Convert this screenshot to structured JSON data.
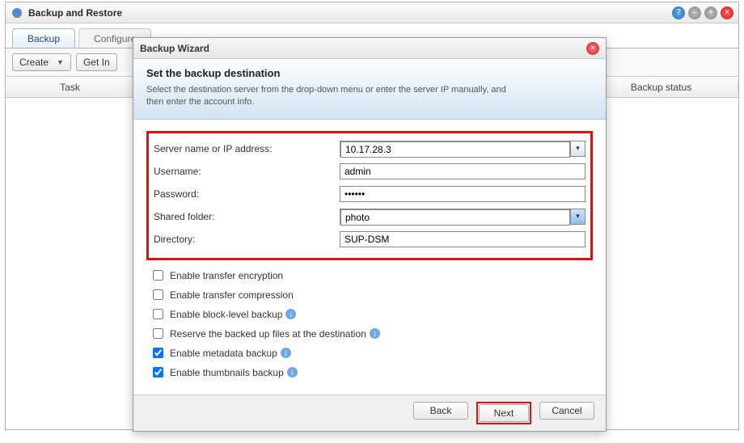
{
  "window": {
    "title": "Backup and Restore"
  },
  "tabs": {
    "backup": "Backup",
    "configure": "Configure"
  },
  "toolbar": {
    "create": "Create",
    "get_info": "Get Info"
  },
  "columns": {
    "task": "Task",
    "status": "Backup status"
  },
  "wizard": {
    "title": "Backup Wizard",
    "heading": "Set the backup destination",
    "desc": "Select the destination server from the drop-down menu or enter the server IP manually, and then enter the account info.",
    "labels": {
      "server": "Server name or IP address:",
      "username": "Username:",
      "password": "Password:",
      "folder": "Shared folder:",
      "directory": "Directory:"
    },
    "values": {
      "server": "10.17.28.3",
      "username": "admin",
      "password": "••••••",
      "folder": "photo",
      "directory": "SUP-DSM"
    },
    "checks": {
      "encrypt": "Enable transfer encryption",
      "compress": "Enable transfer compression",
      "block": "Enable block-level backup",
      "reserve": "Reserve the backed up files at the destination",
      "metadata": "Enable metadata backup",
      "thumbs": "Enable thumbnails backup"
    },
    "buttons": {
      "back": "Back",
      "next": "Next",
      "cancel": "Cancel"
    }
  }
}
